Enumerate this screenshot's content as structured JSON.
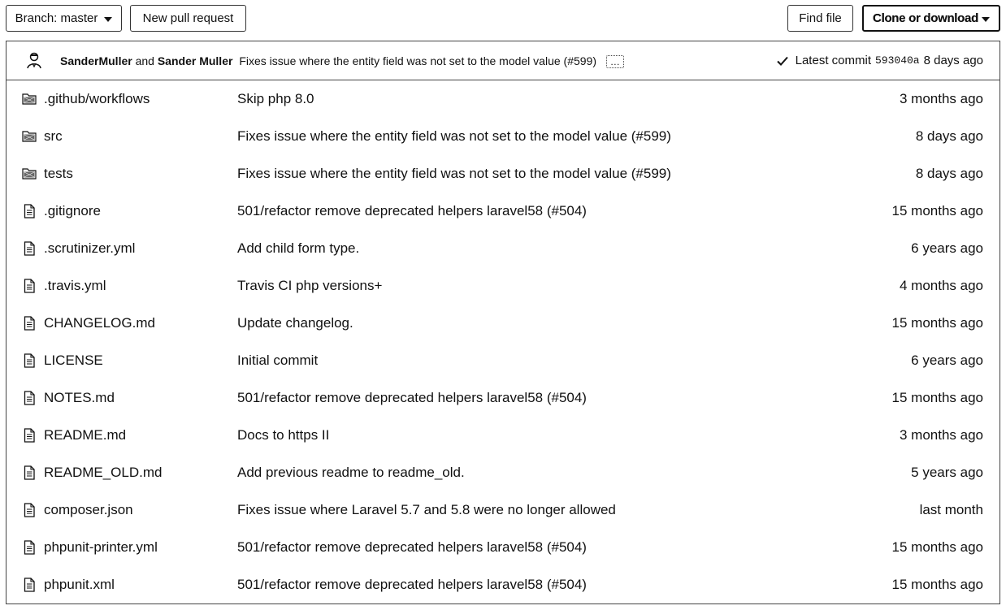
{
  "toolbar": {
    "branch_label": "Branch: master",
    "new_pr_label": "New pull request",
    "find_file_label": "Find file",
    "clone_label": "Clone or download"
  },
  "commit": {
    "author1": "SanderMuller",
    "and_text": "and",
    "author2": "Sander Muller",
    "message": "Fixes issue where the entity field was not set to the model value (#599)",
    "ellipsis": "…",
    "latest_label": "Latest commit",
    "sha": "593040a",
    "age": "8 days ago"
  },
  "files": [
    {
      "type": "folder",
      "name": ".github/workflows",
      "message": "Skip php 8.0",
      "age": "3 months ago"
    },
    {
      "type": "folder",
      "name": "src",
      "message": "Fixes issue where the entity field was not set to the model value (#599)",
      "age": "8 days ago"
    },
    {
      "type": "folder",
      "name": "tests",
      "message": "Fixes issue where the entity field was not set to the model value (#599)",
      "age": "8 days ago"
    },
    {
      "type": "file",
      "name": ".gitignore",
      "message": "501/refactor remove deprecated helpers laravel58 (#504)",
      "age": "15 months ago"
    },
    {
      "type": "file",
      "name": ".scrutinizer.yml",
      "message": "Add child form type.",
      "age": "6 years ago"
    },
    {
      "type": "file",
      "name": ".travis.yml",
      "message": "Travis CI php versions+",
      "age": "4 months ago"
    },
    {
      "type": "file",
      "name": "CHANGELOG.md",
      "message": "Update changelog.",
      "age": "15 months ago"
    },
    {
      "type": "file",
      "name": "LICENSE",
      "message": "Initial commit",
      "age": "6 years ago"
    },
    {
      "type": "file",
      "name": "NOTES.md",
      "message": "501/refactor remove deprecated helpers laravel58 (#504)",
      "age": "15 months ago"
    },
    {
      "type": "file",
      "name": "README.md",
      "message": "Docs to https II",
      "age": "3 months ago"
    },
    {
      "type": "file",
      "name": "README_OLD.md",
      "message": "Add previous readme to readme_old.",
      "age": "5 years ago"
    },
    {
      "type": "file",
      "name": "composer.json",
      "message": "Fixes issue where Laravel 5.7 and 5.8 were no longer allowed",
      "age": "last month"
    },
    {
      "type": "file",
      "name": "phpunit-printer.yml",
      "message": "501/refactor remove deprecated helpers laravel58 (#504)",
      "age": "15 months ago"
    },
    {
      "type": "file",
      "name": "phpunit.xml",
      "message": "501/refactor remove deprecated helpers laravel58 (#504)",
      "age": "15 months ago"
    }
  ]
}
